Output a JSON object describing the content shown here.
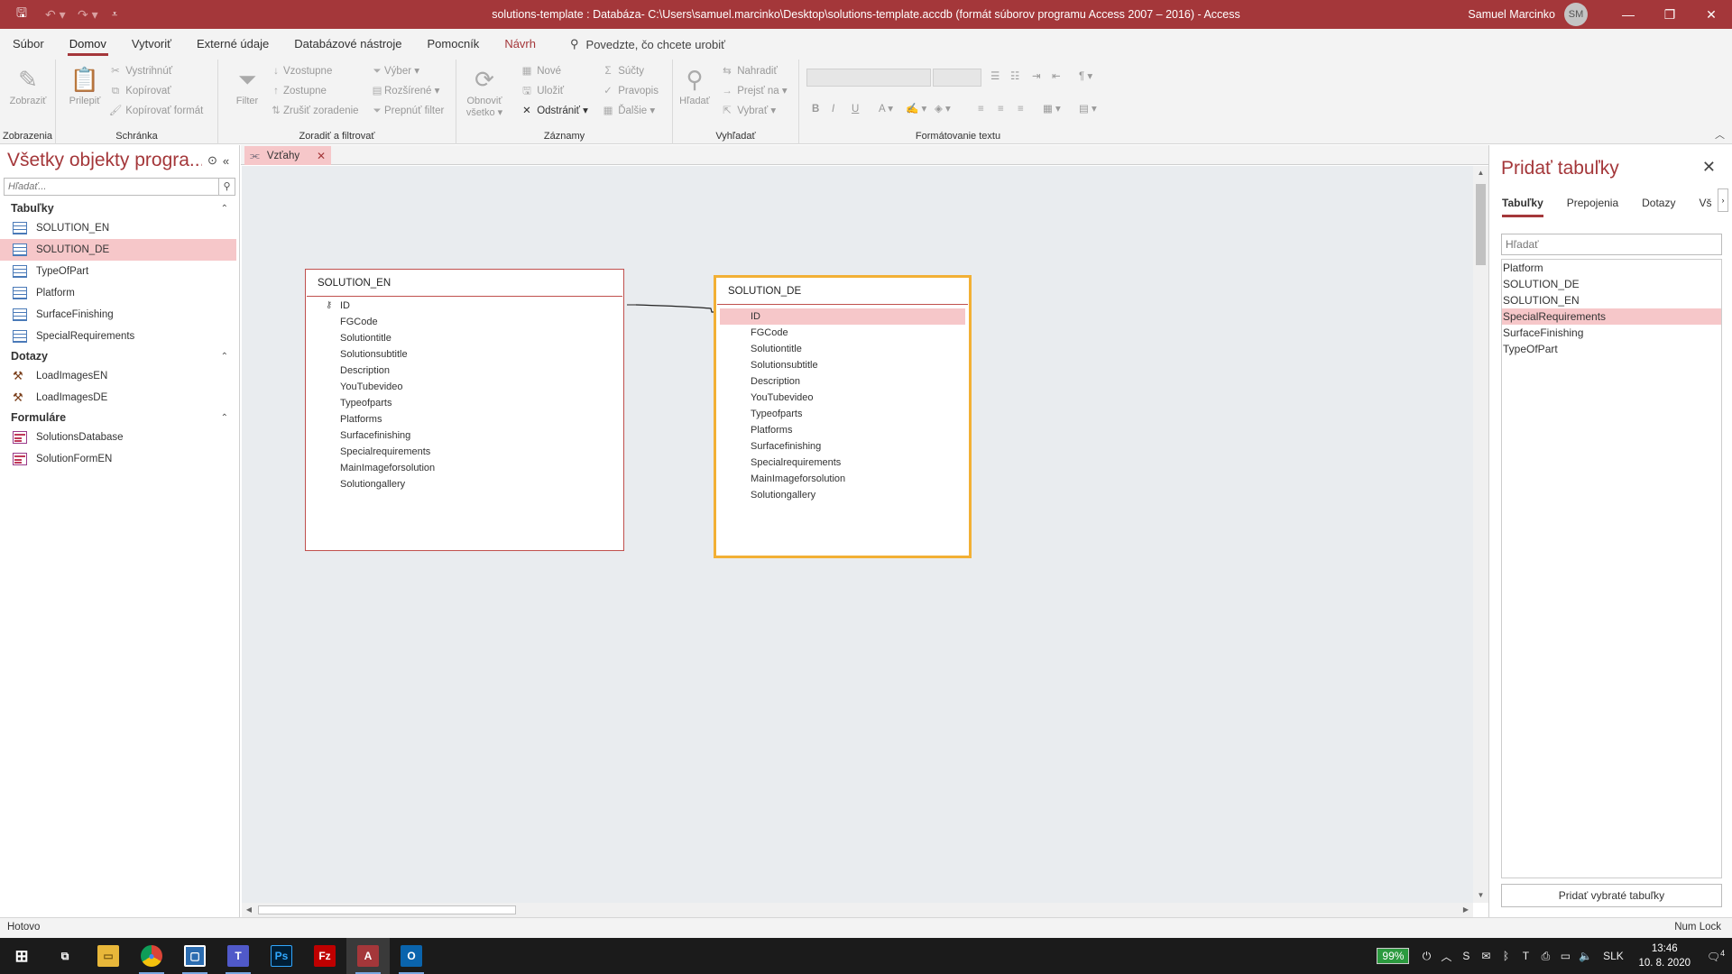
{
  "titlebar": {
    "title": "solutions-template : Databáza- C:\\Users\\samuel.marcinko\\Desktop\\solutions-template.accdb (formát súborov programu Access 2007 – 2016)  -  Access",
    "user_name": "Samuel Marcinko",
    "user_initials": "SM",
    "accent": "#a4373a"
  },
  "menu": {
    "tabs": [
      "Súbor",
      "Domov",
      "Vytvoriť",
      "Externé údaje",
      "Databázové nástroje",
      "Pomocník",
      "Návrh"
    ],
    "active": "Domov",
    "tell_me": "Povedzte, čo chcete urobiť"
  },
  "ribbon": {
    "groups": {
      "views": "Zobrazenia",
      "clipboard": "Schránka",
      "sort_filter": "Zoradiť a filtrovať",
      "records": "Záznamy",
      "find": "Vyhľadať",
      "text_format": "Formátovanie textu"
    },
    "buttons": {
      "view": "Zobraziť",
      "paste": "Prilepiť",
      "cut": "Vystrihnúť",
      "copy": "Kopírovať",
      "format_painter": "Kopírovať formát",
      "filter": "Filter",
      "ascending": "Vzostupne",
      "descending": "Zostupne",
      "remove_sort": "Zrušiť zoradenie",
      "selection": "Výber",
      "advanced": "Rozšírené",
      "toggle_filter": "Prepnúť filter",
      "refresh_1": "Obnoviť",
      "refresh_2": "všetko",
      "new": "Nové",
      "save": "Uložiť",
      "delete": "Odstrániť",
      "totals": "Súčty",
      "spelling": "Pravopis",
      "more": "Ďalšie",
      "find": "Hľadať",
      "replace": "Nahradiť",
      "goto": "Prejsť na",
      "select": "Vybrať",
      "bold": "B",
      "italic": "I",
      "underline": "U"
    }
  },
  "nav": {
    "title": "Všetky objekty progra...",
    "search_placeholder": "Hľadať...",
    "sections": [
      {
        "title": "Tabuľky",
        "icon": "table-icon",
        "items": [
          "SOLUTION_EN",
          "SOLUTION_DE",
          "TypeOfPart",
          "Platform",
          "SurfaceFinishing",
          "SpecialRequirements"
        ]
      },
      {
        "title": "Dotazy",
        "icon": "query-icon",
        "items": [
          "LoadImagesEN",
          "LoadImagesDE"
        ]
      },
      {
        "title": "Formuláre",
        "icon": "form-icon",
        "items": [
          "SolutionsDatabase",
          "SolutionFormEN"
        ]
      }
    ],
    "selected": "SOLUTION_DE"
  },
  "document": {
    "tab_label": "Vzťahy",
    "tables": [
      {
        "name": "SOLUTION_EN",
        "fields": [
          "ID",
          "FGCode",
          "Solutiontitle",
          "Solutionsubtitle",
          "Description",
          "YouTubevideo",
          "Typeofparts",
          "Platforms",
          "Surfacefinishing",
          "Specialrequirements",
          "MainImageforsolution",
          "Solutiongallery"
        ]
      },
      {
        "name": "SOLUTION_DE",
        "fields": [
          "ID",
          "FGCode",
          "Solutiontitle",
          "Solutionsubtitle",
          "Description",
          "YouTubevideo",
          "Typeofparts",
          "Platforms",
          "Surfacefinishing",
          "Specialrequirements",
          "MainImageforsolution",
          "Solutiongallery"
        ]
      }
    ]
  },
  "add_pane": {
    "title": "Pridať tabuľky",
    "tabs": [
      "Tabuľky",
      "Prepojenia",
      "Dotazy",
      "Vš"
    ],
    "active_tab": "Tabuľky",
    "search_placeholder": "Hľadať",
    "items": [
      "Platform",
      "SOLUTION_DE",
      "SOLUTION_EN",
      "SpecialRequirements",
      "SurfaceFinishing",
      "TypeOfPart"
    ],
    "selected": "SpecialRequirements",
    "add_button": "Pridať vybraté tabuľky"
  },
  "status": {
    "left": "Hotovo",
    "right": "Num Lock"
  },
  "taskbar": {
    "battery": "99%",
    "language": "SLK",
    "time": "13:46",
    "date": "10. 8. 2020",
    "notifications": "4"
  }
}
